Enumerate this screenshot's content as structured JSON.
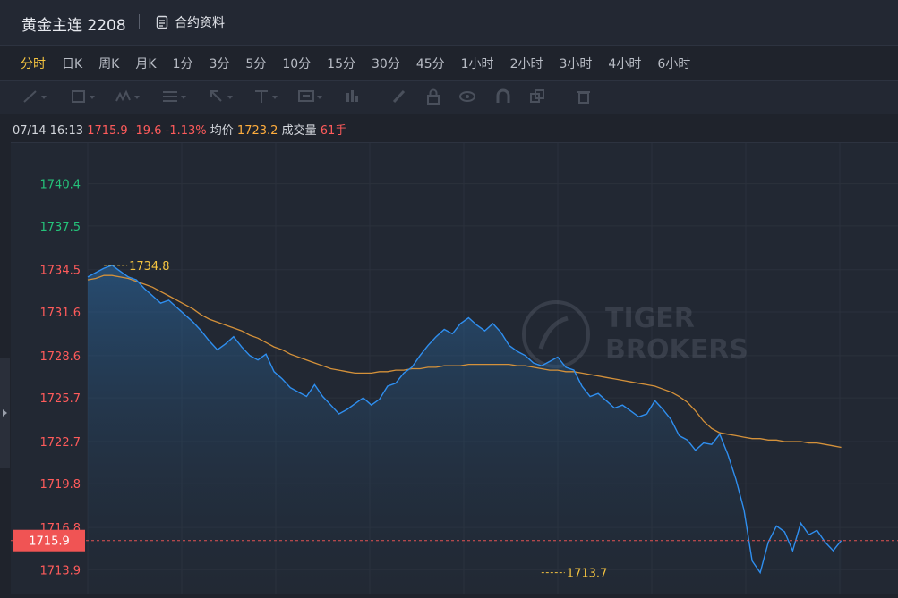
{
  "header": {
    "title": "黄金主连 2208",
    "doc_link_label": "合约资料",
    "doc_icon": "document-icon"
  },
  "periods": [
    "分时",
    "日K",
    "周K",
    "月K",
    "1分",
    "3分",
    "5分",
    "10分",
    "15分",
    "30分",
    "45分",
    "1小时",
    "2小时",
    "3小时",
    "4小时",
    "6小时"
  ],
  "active_period": "分时",
  "toolbar": {
    "tools": [
      "line-tool-icon",
      "rectangle-tool-icon",
      "pattern-tool-icon",
      "fib-tool-icon",
      "arrow-tool-icon",
      "text-tool-icon",
      "measure-tool-icon",
      "indicator-icon",
      "brush-icon",
      "lock-icon",
      "eye-icon",
      "magnet-icon",
      "copy-icon",
      "trash-icon"
    ]
  },
  "info": {
    "datetime": "07/14 16:13",
    "price": "1715.9",
    "change": "-19.6",
    "change_pct": "-1.13%",
    "avg_label": "均价",
    "avg_value": "1723.2",
    "volume_label": "成交量",
    "volume_value": "61手"
  },
  "watermark": {
    "line1": "TIGER",
    "line2": "BROKERS"
  },
  "colors": {
    "up": "#25c37a",
    "down": "#ff5b5b",
    "price_line": "#2f8ff0",
    "avg_line": "#d4913a",
    "accent": "#f5c440"
  },
  "chart_data": {
    "type": "area",
    "yticks": [
      {
        "label": "1740.4",
        "value": 1740.4,
        "color": "green"
      },
      {
        "label": "1737.5",
        "value": 1737.5,
        "color": "green"
      },
      {
        "label": "1734.5",
        "value": 1734.5,
        "color": "red"
      },
      {
        "label": "1731.6",
        "value": 1731.6,
        "color": "red"
      },
      {
        "label": "1728.6",
        "value": 1728.6,
        "color": "red"
      },
      {
        "label": "1725.7",
        "value": 1725.7,
        "color": "red"
      },
      {
        "label": "1722.7",
        "value": 1722.7,
        "color": "red"
      },
      {
        "label": "1719.8",
        "value": 1719.8,
        "color": "red"
      },
      {
        "label": "1716.8",
        "value": 1716.8,
        "color": "red"
      },
      {
        "label": "1713.9",
        "value": 1713.9,
        "color": "red"
      }
    ],
    "ylim": [
      1712.2,
      1743.2
    ],
    "x_slots": 100,
    "current_price": {
      "label": "1715.9",
      "value": 1715.9
    },
    "high": {
      "label": "1734.8",
      "value": 1734.8,
      "x": 2
    },
    "low": {
      "label": "1713.7",
      "value": 1713.7,
      "x": 56
    },
    "series": [
      {
        "values": [
          1734.0,
          1734.3,
          1734.6,
          1734.8,
          1734.4,
          1734.0,
          1733.8,
          1733.2,
          1732.7,
          1732.2,
          1732.4,
          1731.9,
          1731.4,
          1730.9,
          1730.3,
          1729.6,
          1729.0,
          1729.4,
          1729.9,
          1729.2,
          1728.6,
          1728.3,
          1728.7,
          1727.5,
          1727.0,
          1726.4,
          1726.1,
          1725.8,
          1726.6,
          1725.8,
          1725.2,
          1724.6,
          1724.9,
          1725.3,
          1725.7,
          1725.2,
          1725.6,
          1726.5,
          1726.7,
          1727.4,
          1727.8,
          1728.6,
          1729.3,
          1729.9,
          1730.4,
          1730.1,
          1730.8,
          1731.2,
          1730.7,
          1730.3,
          1730.8,
          1730.2,
          1729.3,
          1728.9,
          1728.6,
          1728.1,
          1727.9,
          1728.2,
          1728.5,
          1727.8,
          1727.6,
          1726.5,
          1725.8,
          1726.0,
          1725.5,
          1725.0,
          1725.2,
          1724.8,
          1724.4,
          1724.6,
          1725.5,
          1724.9,
          1724.2,
          1723.1,
          1722.8,
          1722.1,
          1722.6,
          1722.5,
          1723.2,
          1721.8,
          1720.1,
          1718.0,
          1714.5,
          1713.7,
          1715.8,
          1716.9,
          1716.5,
          1715.2,
          1717.1,
          1716.3,
          1716.6,
          1715.8,
          1715.2,
          1715.9
        ]
      },
      {
        "values": [
          1733.8,
          1733.9,
          1734.1,
          1734.1,
          1734.0,
          1733.9,
          1733.7,
          1733.5,
          1733.3,
          1733.0,
          1732.7,
          1732.4,
          1732.1,
          1731.8,
          1731.4,
          1731.1,
          1730.9,
          1730.7,
          1730.5,
          1730.3,
          1730.0,
          1729.8,
          1729.5,
          1729.2,
          1729.0,
          1728.7,
          1728.5,
          1728.3,
          1728.1,
          1727.9,
          1727.7,
          1727.6,
          1727.5,
          1727.4,
          1727.4,
          1727.4,
          1727.5,
          1727.5,
          1727.6,
          1727.6,
          1727.7,
          1727.7,
          1727.8,
          1727.8,
          1727.9,
          1727.9,
          1727.9,
          1728.0,
          1728.0,
          1728.0,
          1728.0,
          1728.0,
          1728.0,
          1727.9,
          1727.9,
          1727.8,
          1727.7,
          1727.6,
          1727.6,
          1727.5,
          1727.5,
          1727.4,
          1727.3,
          1727.2,
          1727.1,
          1727.0,
          1726.9,
          1726.8,
          1726.7,
          1726.6,
          1726.5,
          1726.3,
          1726.1,
          1725.8,
          1725.4,
          1724.8,
          1724.1,
          1723.6,
          1723.3,
          1723.2,
          1723.1,
          1723.0,
          1722.9,
          1722.9,
          1722.8,
          1722.8,
          1722.7,
          1722.7,
          1722.7,
          1722.6,
          1722.6,
          1722.5,
          1722.4,
          1722.3
        ]
      }
    ],
    "grid": true
  }
}
